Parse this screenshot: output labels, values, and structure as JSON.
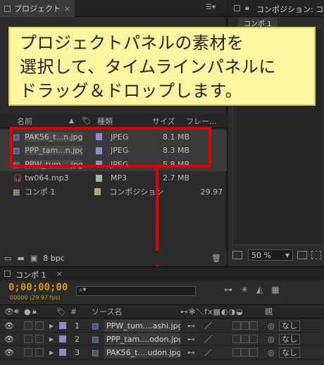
{
  "project_panel": {
    "tab_label": "プロジェクト",
    "close_glyph": "×",
    "columns": {
      "name": "名前",
      "type": "種類",
      "size": "サイズ",
      "frame": "フレー..."
    },
    "items": [
      {
        "name": "PAK56_t...n.jpg",
        "type": "JPEG",
        "size": "8.1 MB",
        "frame": "",
        "icon": "image-icon",
        "label_color": "#8c8cc8",
        "selected": true
      },
      {
        "name": "PPP_tam...n.jpg",
        "type": "JPEG",
        "size": "8.3 MB",
        "frame": "",
        "icon": "image-icon",
        "label_color": "#8c8cc8",
        "selected": true
      },
      {
        "name": "PPW_tum....jpg",
        "type": "JPEG",
        "size": "5.8 MB",
        "frame": "",
        "icon": "image-icon",
        "label_color": "#8c8cc8",
        "selected": true
      },
      {
        "name": "tw064.mp3",
        "type": "MP3",
        "size": "2.7 MB",
        "frame": "",
        "icon": "audio-icon",
        "label_color": "#9fb89f",
        "selected": false
      },
      {
        "name": "コンポ 1",
        "type": "コンポジション",
        "size": "",
        "frame": "29.97",
        "icon": "composition-icon",
        "label_color": "#b8a27a",
        "selected": false
      }
    ],
    "bpc_label": "8 bpc"
  },
  "comp_panel": {
    "tab_label": "コンポジション: コ",
    "sub_tab": "コンポ 1",
    "zoom": "50 %"
  },
  "callout": {
    "lines": [
      "プロジェクトパネルの素材を",
      "選択して、タイムラインパネルに",
      "ドラッグ＆ドロップします。"
    ]
  },
  "timeline": {
    "tab_label": "コンポ 1",
    "timecode": "0;00;00;00",
    "fps_label": "00000 (29.97 fps)",
    "search_placeholder": "",
    "headers": {
      "num": "#",
      "source": "ソース名",
      "parent": "親"
    },
    "layers": [
      {
        "num": "1",
        "name": "PPW_tum....ashi.jpg",
        "parent": "なし"
      },
      {
        "num": "2",
        "name": "PPP_tam....odon.jpg",
        "parent": "なし"
      },
      {
        "num": "3",
        "name": "PAK56_t....udon.jpg",
        "parent": "なし"
      }
    ]
  },
  "colors": {
    "highlight_red": "#e10000",
    "callout_bg": "#fbf59f",
    "timecode": "#d29a1c"
  }
}
